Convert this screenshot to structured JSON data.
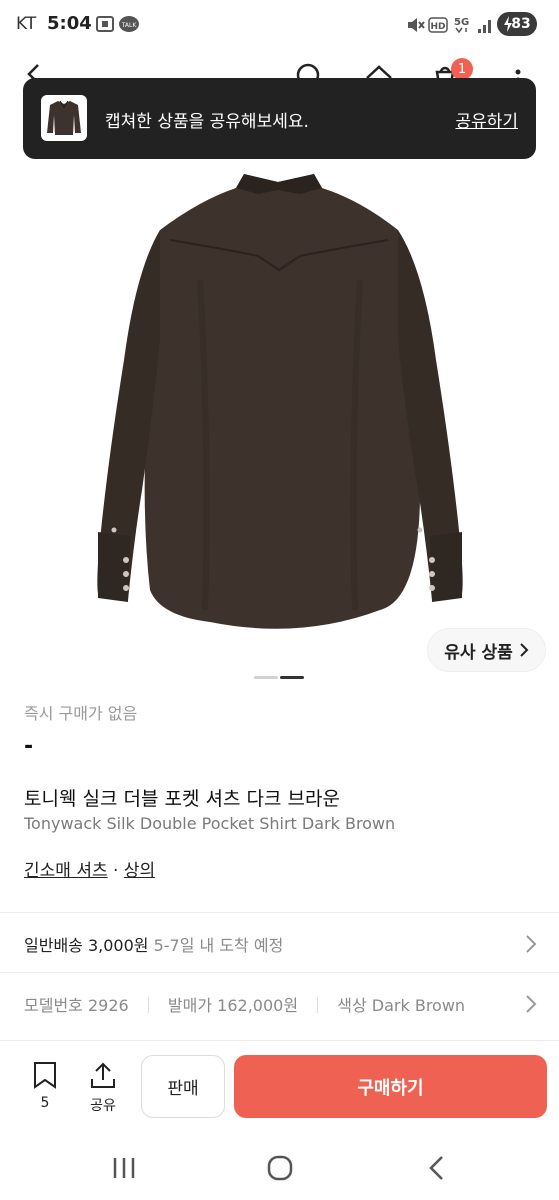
{
  "status_bar": {
    "carrier": "KT",
    "time": "5:04",
    "talk_badge": "TALK",
    "network": "5G",
    "hd": "HD",
    "battery": "83"
  },
  "header": {
    "cart_count": "1"
  },
  "toast": {
    "message": "캡쳐한 상품을 공유해보세요.",
    "action": "공유하기"
  },
  "gallery": {
    "similar_label": "유사 상품"
  },
  "product": {
    "instant_label": "즉시 구매가 없음",
    "price": "-",
    "name_ko": "토니웩 실크 더블 포켓 셔츠 다크 브라운",
    "name_en": "Tonywack Silk Double Pocket Shirt Dark Brown",
    "category1": "긴소매 셔츠",
    "category_sep": "·",
    "category2": "상의"
  },
  "shipping": {
    "label": "일반배송 3,000원",
    "eta": "5-7일 내 도착 예정"
  },
  "specs": {
    "model_label": "모델번호",
    "model_value": "2926",
    "release_label": "발매가",
    "release_value": "162,000원",
    "color_label": "색상",
    "color_value": "Dark Brown"
  },
  "actions": {
    "bookmark_count": "5",
    "share_label": "공유",
    "sell_label": "판매",
    "buy_label": "구매하기"
  },
  "colors": {
    "accent": "#ef6253",
    "toast_bg": "#222222",
    "shirt": "#3d332c"
  }
}
